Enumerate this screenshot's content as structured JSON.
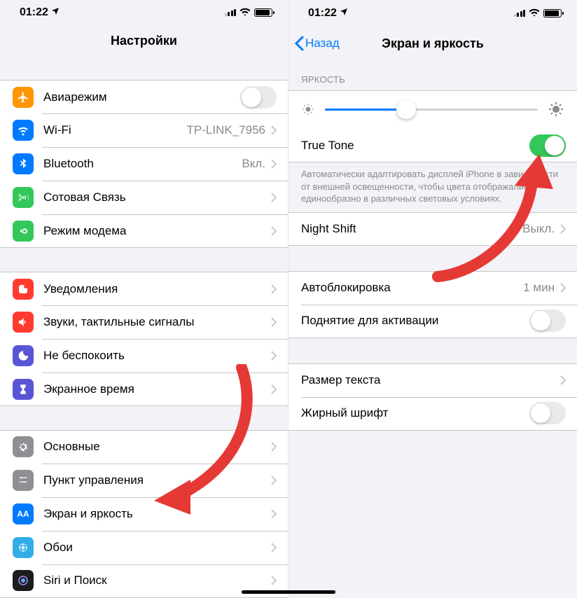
{
  "status": {
    "time": "01:22"
  },
  "left": {
    "title": "Настройки",
    "rows": {
      "airplane": "Авиарежим",
      "wifi": "Wi-Fi",
      "wifi_value": "TP-LINK_7956",
      "bluetooth": "Bluetooth",
      "bluetooth_value": "Вкл.",
      "cellular": "Сотовая Связь",
      "hotspot": "Режим модема",
      "notifications": "Уведомления",
      "sounds": "Звуки, тактильные сигналы",
      "dnd": "Не беспокоить",
      "screentime": "Экранное время",
      "general": "Основные",
      "controlcenter": "Пункт управления",
      "display": "Экран и яркость",
      "wallpaper": "Обои",
      "siri": "Siri и Поиск"
    }
  },
  "right": {
    "back": "Назад",
    "title": "Экран и яркость",
    "brightness_header": "ЯРКОСТЬ",
    "brightness_percent": 38,
    "truetone": "True Tone",
    "truetone_desc": "Автоматически адаптировать дисплей iPhone в зависимости от внешней освещенности, чтобы цвета отображались единообразно в различных световых условиях.",
    "nightshift": "Night Shift",
    "nightshift_value": "Выкл.",
    "autolock": "Автоблокировка",
    "autolock_value": "1 мин",
    "raise": "Поднятие для активации",
    "textsize": "Размер текста",
    "bold": "Жирный шрифт"
  }
}
